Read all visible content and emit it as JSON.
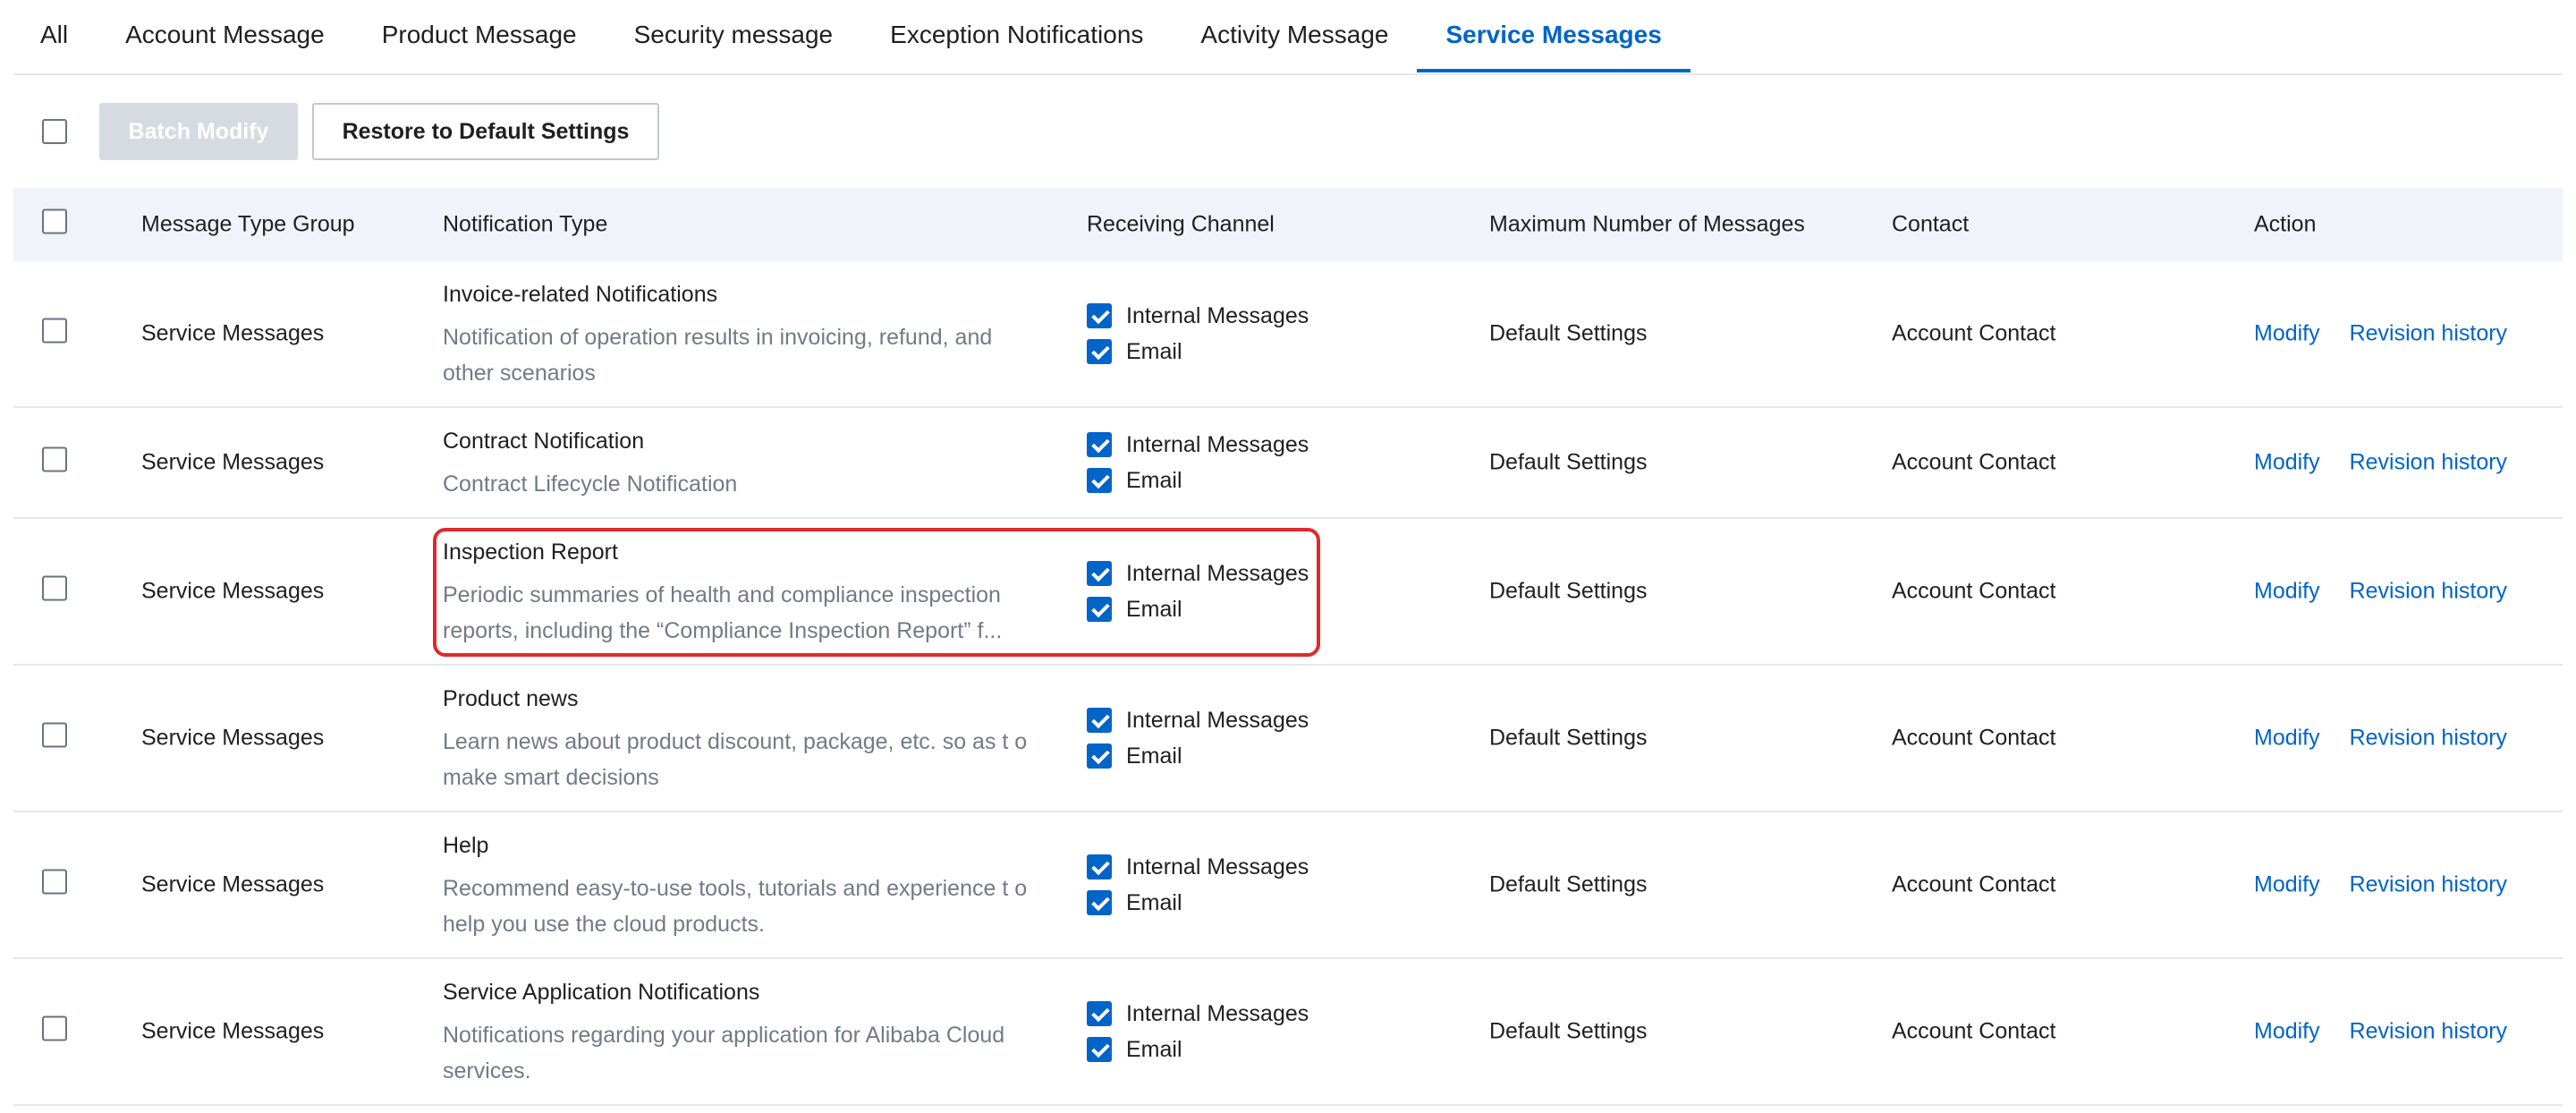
{
  "tabs": [
    {
      "label": "All",
      "active": false
    },
    {
      "label": "Account Message",
      "active": false
    },
    {
      "label": "Product Message",
      "active": false
    },
    {
      "label": "Security message",
      "active": false
    },
    {
      "label": "Exception Notifications",
      "active": false
    },
    {
      "label": "Activity Message",
      "active": false
    },
    {
      "label": "Service Messages",
      "active": true
    }
  ],
  "toolbar": {
    "batch_modify_label": "Batch Modify",
    "restore_label": "Restore to Default Settings"
  },
  "table": {
    "headers": {
      "group": "Message Type Group",
      "type": "Notification Type",
      "channel": "Receiving Channel",
      "max": "Maximum Number of Messages",
      "contact": "Contact",
      "action": "Action"
    },
    "rows": [
      {
        "group": "Service Messages",
        "title": "Invoice-related Notifications",
        "desc": "Notification of operation results in invoicing, refund, and other scenarios",
        "channel1": "Internal Messages",
        "channel2": "Email",
        "max": "Default Settings",
        "contact": "Account Contact",
        "modify": "Modify",
        "history": "Revision history"
      },
      {
        "group": "Service Messages",
        "title": "Contract Notification",
        "desc": "Contract Lifecycle Notification",
        "channel1": "Internal Messages",
        "channel2": "Email",
        "max": "Default Settings",
        "contact": "Account Contact",
        "modify": "Modify",
        "history": "Revision history"
      },
      {
        "group": "Service Messages",
        "title": "Inspection Report",
        "desc": "Periodic summaries of health and compliance inspection reports, including the “Compliance Inspection Report” f...",
        "channel1": "Internal Messages",
        "channel2": "Email",
        "max": "Default Settings",
        "contact": "Account Contact",
        "modify": "Modify",
        "history": "Revision history"
      },
      {
        "group": "Service Messages",
        "title": "Product news",
        "desc": "Learn news about product discount, package, etc. so as t o make smart decisions",
        "channel1": "Internal Messages",
        "channel2": "Email",
        "max": "Default Settings",
        "contact": "Account Contact",
        "modify": "Modify",
        "history": "Revision history"
      },
      {
        "group": "Service Messages",
        "title": "Help",
        "desc": "Recommend easy-to-use tools, tutorials and experience t o help you use the cloud products.",
        "channel1": "Internal Messages",
        "channel2": "Email",
        "max": "Default Settings",
        "contact": "Account Contact",
        "modify": "Modify",
        "history": "Revision history"
      },
      {
        "group": "Service Messages",
        "title": "Service Application Notifications",
        "desc": "Notifications regarding your application for Alibaba Cloud services.",
        "channel1": "Internal Messages",
        "channel2": "Email",
        "max": "Default Settings",
        "contact": "Account Contact",
        "modify": "Modify",
        "history": "Revision history"
      }
    ]
  },
  "colors": {
    "accent": "#0064c8",
    "highlight": "#e0282e",
    "header_bg": "#f0f3f9"
  }
}
